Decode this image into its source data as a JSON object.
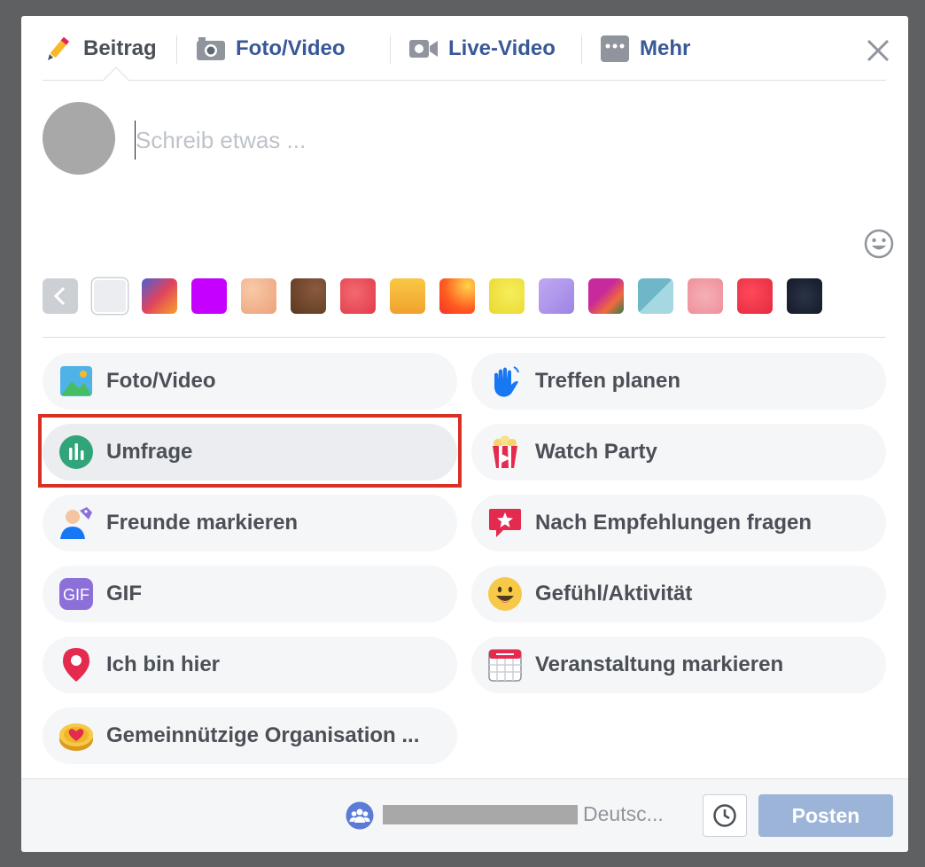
{
  "tabs": [
    {
      "label": "Beitrag",
      "icon": "pencil-icon",
      "active": true
    },
    {
      "label": "Foto/Video",
      "icon": "camera-icon"
    },
    {
      "label": "Live-Video",
      "icon": "video-camera-icon"
    },
    {
      "label": "Mehr",
      "icon": "more-icon"
    }
  ],
  "composer": {
    "placeholder": "Schreib etwas ..."
  },
  "options": [
    {
      "label": "Foto/Video",
      "icon": "photo-icon"
    },
    {
      "label": "Treffen planen",
      "icon": "waving-hand-icon"
    },
    {
      "label": "Umfrage",
      "icon": "poll-icon",
      "highlighted": true
    },
    {
      "label": "Watch Party",
      "icon": "popcorn-icon"
    },
    {
      "label": "Freunde markieren",
      "icon": "tag-friends-icon"
    },
    {
      "label": "Nach Empfehlungen fragen",
      "icon": "recommendation-icon"
    },
    {
      "label": "GIF",
      "icon": "gif-icon"
    },
    {
      "label": "Gefühl/Aktivität",
      "icon": "smiley-icon"
    },
    {
      "label": "Ich bin hier",
      "icon": "location-pin-icon"
    },
    {
      "label": "Veranstaltung markieren",
      "icon": "calendar-icon"
    },
    {
      "label": "Gemeinnützige Organisation ...",
      "icon": "charity-coin-icon"
    }
  ],
  "footer": {
    "audience_label": "Deutsc...",
    "post_label": "Posten"
  },
  "colors": {
    "link_blue": "#385898",
    "post_button_disabled": "#9cb4d8",
    "highlight_border": "#d93025"
  }
}
